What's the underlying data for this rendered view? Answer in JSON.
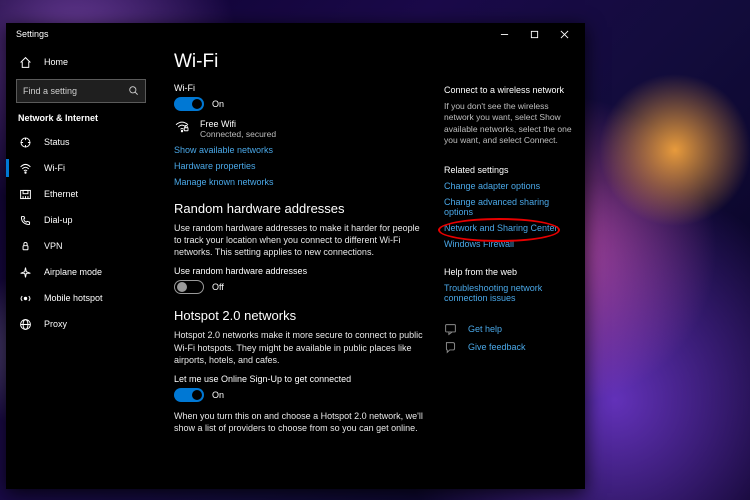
{
  "window": {
    "title": "Settings"
  },
  "sidebar": {
    "home": "Home",
    "search_placeholder": "Find a setting",
    "category": "Network & Internet",
    "items": [
      {
        "icon": "status",
        "label": "Status"
      },
      {
        "icon": "wifi",
        "label": "Wi-Fi"
      },
      {
        "icon": "ethernet",
        "label": "Ethernet"
      },
      {
        "icon": "dialup",
        "label": "Dial-up"
      },
      {
        "icon": "vpn",
        "label": "VPN"
      },
      {
        "icon": "airplane",
        "label": "Airplane mode"
      },
      {
        "icon": "hotspot",
        "label": "Mobile hotspot"
      },
      {
        "icon": "proxy",
        "label": "Proxy"
      }
    ]
  },
  "page": {
    "title": "Wi-Fi",
    "wifi_label": "Wi-Fi",
    "wifi_state": "On",
    "network": {
      "name": "Free Wifi",
      "status": "Connected, secured"
    },
    "links_top": {
      "show_available": "Show available networks",
      "hw_props": "Hardware properties",
      "manage_known": "Manage known networks"
    },
    "random": {
      "title": "Random hardware addresses",
      "desc": "Use random hardware addresses to make it harder for people to track your location when you connect to different Wi-Fi networks. This setting applies to new connections.",
      "label": "Use random hardware addresses",
      "state": "Off"
    },
    "hotspot": {
      "title": "Hotspot 2.0 networks",
      "desc": "Hotspot 2.0 networks make it more secure to connect to public Wi-Fi hotspots. They might be available in public places like airports, hotels, and cafes.",
      "label": "Let me use Online Sign-Up to get connected",
      "state": "On",
      "desc2": "When you turn this on and choose a Hotspot 2.0 network, we'll show a list of providers to choose from so you can get online."
    }
  },
  "right": {
    "connect_title": "Connect to a wireless network",
    "connect_desc": "If you don't see the wireless network you want, select Show available networks, select the one you want, and select Connect.",
    "related_title": "Related settings",
    "related": {
      "adapter": "Change adapter options",
      "advanced": "Change advanced sharing options",
      "center": "Network and Sharing Center",
      "firewall": "Windows Firewall"
    },
    "help_title": "Help from the web",
    "help_link": "Troubleshooting network connection issues",
    "get_help": "Get help",
    "feedback": "Give feedback"
  }
}
